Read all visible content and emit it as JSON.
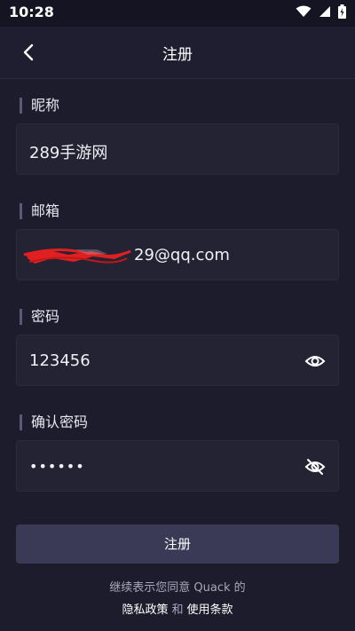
{
  "status_bar": {
    "time": "10:28"
  },
  "header": {
    "title": "注册"
  },
  "form": {
    "nickname": {
      "label": "昵称",
      "value": "289手游网"
    },
    "email": {
      "label": "邮箱",
      "value": "29@qq.com"
    },
    "password": {
      "label": "密码",
      "value": "123456"
    },
    "confirm_password": {
      "label": "确认密码",
      "value": "••••••"
    }
  },
  "submit_label": "注册",
  "terms": {
    "line1": "继续表示您同意 Quack 的",
    "privacy_link": "隐私政策",
    "and_text": "和",
    "terms_link": "使用条款"
  },
  "colors": {
    "background": "#1c1c2c",
    "field_bg": "#232334",
    "button_bg": "#3a3a56",
    "redaction": "#e02020"
  },
  "icons": [
    "back-arrow-icon",
    "eye-icon",
    "eye-off-icon",
    "wifi-icon",
    "signal-icon",
    "battery-icon"
  ]
}
